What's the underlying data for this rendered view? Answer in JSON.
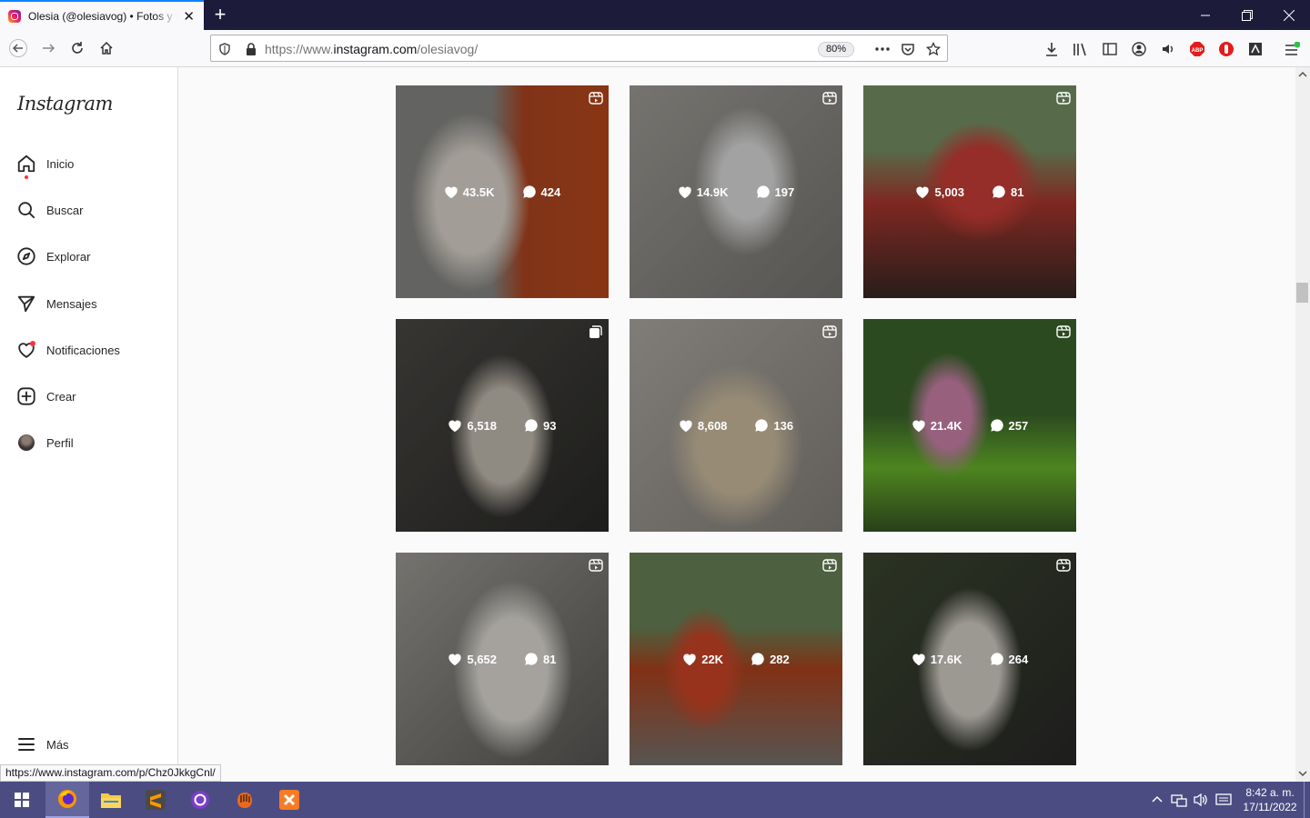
{
  "browser": {
    "tab_title": "Olesia (@olesiavog) • Fotos y videos de Instagram",
    "url_prefix": "https://www.",
    "url_host": "instagram.com",
    "url_path": "/olesiavog/",
    "zoom": "80%",
    "status_url": "https://www.instagram.com/p/Chz0JkkgCnl/"
  },
  "sidebar": {
    "logo": "Instagram",
    "items": [
      {
        "label": "Inicio",
        "icon": "home-icon"
      },
      {
        "label": "Buscar",
        "icon": "search-icon"
      },
      {
        "label": "Explorar",
        "icon": "compass-icon"
      },
      {
        "label": "Mensajes",
        "icon": "send-icon"
      },
      {
        "label": "Notificaciones",
        "icon": "heart-icon"
      },
      {
        "label": "Crear",
        "icon": "plus-square-icon"
      },
      {
        "label": "Perfil",
        "icon": "avatar"
      }
    ],
    "more": "Más"
  },
  "posts": [
    {
      "likes": "43.5K",
      "comments": "424",
      "type": "reel"
    },
    {
      "likes": "14.9K",
      "comments": "197",
      "type": "reel"
    },
    {
      "likes": "5,003",
      "comments": "81",
      "type": "reel"
    },
    {
      "likes": "6,518",
      "comments": "93",
      "type": "carousel"
    },
    {
      "likes": "8,608",
      "comments": "136",
      "type": "reel"
    },
    {
      "likes": "21.4K",
      "comments": "257",
      "type": "reel"
    },
    {
      "likes": "5,652",
      "comments": "81",
      "type": "reel"
    },
    {
      "likes": "22K",
      "comments": "282",
      "type": "reel"
    },
    {
      "likes": "17.6K",
      "comments": "264",
      "type": "reel"
    }
  ],
  "taskbar": {
    "time": "8:42 a. m.",
    "date": "17/11/2022"
  }
}
